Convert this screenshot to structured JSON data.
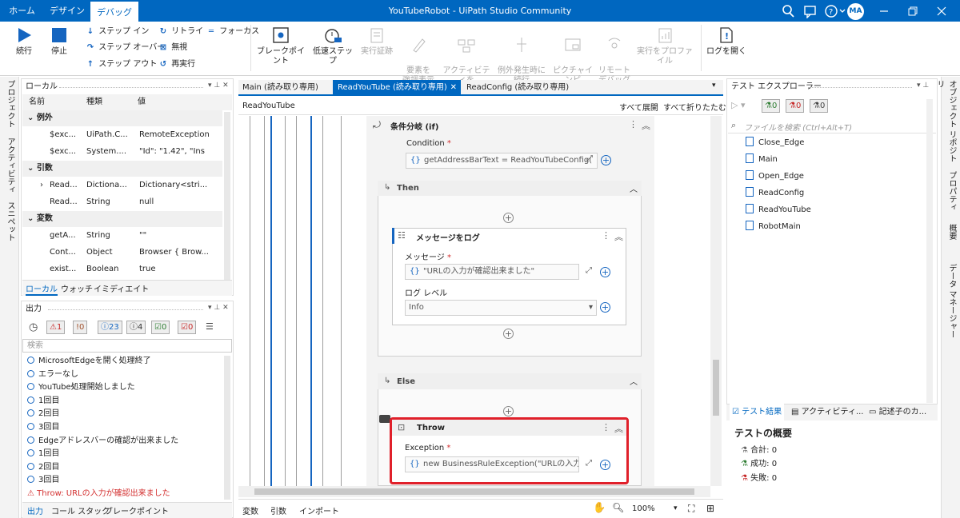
{
  "app_title": "YouTubeRobot - UiPath Studio Community",
  "ribbon_tabs": [
    "ホーム",
    "デザイン",
    "デバッグ"
  ],
  "user_initials": "MA",
  "ribbon": {
    "continue": "続行",
    "stop": "停止",
    "step_in": "ステップ イン",
    "step_over": "ステップ オーバー",
    "step_out": "ステップ アウト",
    "retry": "リトライ",
    "ignore": "無視",
    "rerun": "再実行",
    "focus": "フォーカス",
    "breakpoint": "ブレークポイント",
    "slow_step": "低速ステップ",
    "execution_trail": "実行証跡",
    "highlight": "要素を\n強調表示",
    "log_activities": "アクティビティを\nログ",
    "continue_on_exception": "例外発生時に\n続行",
    "picture_in_picture": "ピクチャインピ\nクチャ",
    "remote_debug": "リモート\nデバッグ",
    "profile_execution": "実行をプロファイル",
    "open_logs": "ログを開く"
  },
  "left_vtabs": [
    "プロジェクト",
    "アクティビティ",
    "スニペット"
  ],
  "right_vtabs": [
    "オブジェクト リポジトリ",
    "プロパティ",
    "概要",
    "データ マネージャー"
  ],
  "locals": {
    "title": "ローカル",
    "columns": [
      "名前",
      "種類",
      "値"
    ],
    "sections": [
      {
        "label": "例外",
        "rows": [
          {
            "name": "$exc...",
            "type": "UiPath.C...",
            "value": "RemoteException"
          },
          {
            "name": "$exc...",
            "type": "System....",
            "value": "\"Id\": \"1.42\",  \"Ins"
          }
        ]
      },
      {
        "label": "引数",
        "rows": [
          {
            "name": "Read...",
            "type": "Dictiona...",
            "value": "Dictionary<stri..."
          },
          {
            "name": "Read...",
            "type": "String",
            "value": "null"
          }
        ]
      },
      {
        "label": "変数",
        "rows": [
          {
            "name": "getA...",
            "type": "String",
            "value": "\"\""
          },
          {
            "name": "Cont...",
            "type": "Object",
            "value": "Browser { Brow..."
          },
          {
            "name": "exist...",
            "type": "Boolean",
            "value": "true"
          }
        ]
      }
    ],
    "tabs": [
      "ローカル",
      "ウォッチ",
      "イミディエイト"
    ]
  },
  "output": {
    "title": "出力",
    "counts": [
      "1",
      "0",
      "23",
      "4",
      "0",
      "0"
    ],
    "search_placeholder": "検索",
    "lines": [
      "MicrosoftEdgeを開く処理終了",
      "エラーなし",
      "YouTube処理開始しました",
      "1回目",
      "2回目",
      "3回目",
      "Edgeアドレスバーの確認が出来ました",
      "1回目",
      "2回目",
      "3回目"
    ],
    "error_line": "Throw: URLの入力が確認出来ました",
    "tabs": [
      "出力",
      "コール スタック",
      "ブレークポイント"
    ]
  },
  "doc_tabs": [
    "Main (読み取り専用)",
    "ReadYouTube (読み取り専用)",
    "ReadConfig (読み取り専用)"
  ],
  "designer": {
    "breadcrumb": "ReadYouTube",
    "expand_all": "すべて展開",
    "collapse_all": "すべて折りたたむ",
    "if_title": "条件分岐 (if)",
    "condition_label": "Condition",
    "condition_value": "getAddressBarText = ReadYouTubeConfig(",
    "then_label": "Then",
    "log_title": "メッセージをログ",
    "message_label": "メッセージ",
    "message_value": "\"URLの入力が確認出来ました\"",
    "log_level_label": "ログ レベル",
    "log_level_value": "Info",
    "else_label": "Else",
    "throw_title": "Throw",
    "exception_label": "Exception",
    "exception_value": "new BusinessRuleException(\"URLの入力が",
    "required_mark": "*",
    "bottom_tabs": [
      "変数",
      "引数",
      "インポート"
    ],
    "zoom": "100%"
  },
  "test_explorer": {
    "title": "テスト エクスプローラー",
    "counts": [
      "0",
      "0",
      "0"
    ],
    "search_placeholder": "ファイルを検索 (Ctrl+Alt+T)",
    "items": [
      "Close_Edge",
      "Main",
      "Open_Edge",
      "ReadConfig",
      "ReadYouTube",
      "RobotMain"
    ],
    "tabs": [
      "テスト結果",
      "アクティビティ...",
      "記述子のカ..."
    ],
    "summary_title": "テストの概要",
    "total": "合計: 0",
    "passed": "成功: 0",
    "failed": "失敗: 0"
  },
  "colors": {
    "accent": "#0067c0",
    "error_red": "#d32f2f",
    "throw_border": "#e0202a"
  }
}
